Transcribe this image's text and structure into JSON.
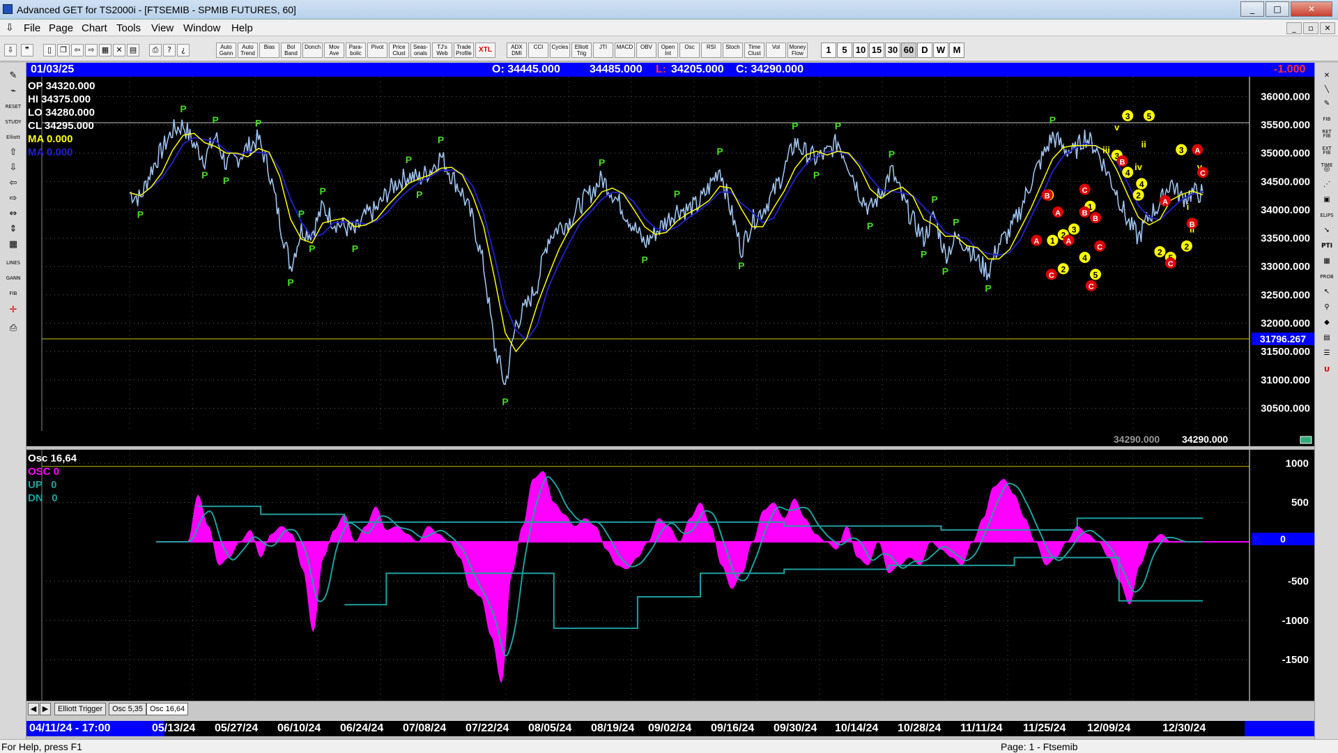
{
  "window": {
    "title": "Advanced GET for TS2000i - [FTSEMIB - SPMIB FUTURES, 60]",
    "min": "_",
    "max": "□",
    "close": "✕",
    "mdi_min": "_",
    "mdi_restore": "▫",
    "mdi_close": "✕"
  },
  "menu": [
    "File",
    "Page",
    "Chart",
    "Tools",
    "View",
    "Window",
    "Help"
  ],
  "toolbar": {
    "study_buttons": [
      "Auto Gann",
      "Auto Trend",
      "Bias",
      "Bol Band",
      "Donch",
      "Mov Ave",
      "Para- bolic",
      "Pivot",
      "Price Clust",
      "Seas- onals",
      "TJ's Web",
      "Trade Profile",
      "XTL",
      "ADX DMI",
      "CCI",
      "Cycles",
      "Elliott Trig",
      "JTI",
      "MACD",
      "OBV",
      "Open Int",
      "Osc",
      "RSI",
      "Stoch",
      "Time Clust",
      "Vol",
      "Money Flow"
    ],
    "timeframes": [
      "1",
      "5",
      "10",
      "15",
      "30",
      "60",
      "D",
      "W",
      "M"
    ]
  },
  "left_tools": [
    "pencil-icon",
    "chart-icon",
    "reset",
    "study",
    "elliott",
    "up-arrow-icon",
    "down-arrow-icon",
    "left-arrow-icon",
    "right-arrow-icon",
    "compress-icon",
    "expand-icon",
    "grid-icon",
    "lines",
    "gann",
    "fib",
    "crosshair-icon",
    "print-icon"
  ],
  "left_labels": [
    "RESET",
    "STUDY",
    "Elliott",
    "LINES",
    "GANN",
    "FIB"
  ],
  "right_labels": [
    "FIB RET",
    "FIB EXT",
    "FIB TIME",
    "ELIPS",
    "PTI",
    "PROB"
  ],
  "info": {
    "date": "01/03/25",
    "open": "O: 34445.000",
    "high": "34485.000",
    "low_label": "L:",
    "low": "34205.000",
    "close": "C: 34290.000",
    "change": "-1.000"
  },
  "price_panel": {
    "readouts": [
      {
        "label": "OP",
        "value": "34320.000"
      },
      {
        "label": "HI",
        "value": "34375.000"
      },
      {
        "label": "LO",
        "value": "34280.000"
      },
      {
        "label": "CL",
        "value": "34295.000"
      }
    ],
    "ma_yellow": "MA  0.000",
    "ma_blue": "MA  0.000",
    "bottom_value_1": "34290.000",
    "bottom_value_2": "34290.000",
    "highlight_value": "31796.267"
  },
  "osc_panel": {
    "title": "Osc 16,64",
    "osc_label": "OSC",
    "osc_value": "0",
    "up_label": "UP",
    "up_value": "0",
    "dn_label": "DN",
    "dn_value": "0",
    "zero_label": "0"
  },
  "tabs": [
    "Elliott Trigger",
    "Osc 5,35",
    "Osc 16,64"
  ],
  "date_axis": {
    "start": "04/11/24 - 17:00",
    "labels": [
      "05/13/24",
      "05/27/24",
      "06/10/24",
      "06/24/24",
      "07/08/24",
      "07/22/24",
      "08/05/24",
      "08/19/24",
      "09/02/24",
      "09/16/24",
      "09/30/24",
      "10/14/24",
      "10/28/24",
      "11/11/24",
      "11/25/24",
      "12/09/24",
      "12/30/24"
    ]
  },
  "status": {
    "left": "For Help, press F1",
    "right": "Page: 1 - Ftsemib"
  },
  "colors": {
    "price_line": "#9ec3ee",
    "ma_yellow": "#ffff00",
    "ma_blue": "#2020c0",
    "pivot_green": "#44dd22",
    "osc_magenta": "#ff00ff",
    "osc_band": "#20a0a0",
    "elliott_red": "#dd0000"
  },
  "chart_data": [
    {
      "type": "line",
      "title": "",
      "y_ticks": [
        "36000.000",
        "35500.000",
        "35000.000",
        "34500.000",
        "34000.000",
        "33500.000",
        "33000.000",
        "32500.000",
        "32000.000",
        "31500.000",
        "31000.000",
        "30500.000"
      ],
      "ylim": [
        30100,
        36250
      ],
      "x_range": [
        0,
        100
      ],
      "series": [
        {
          "values_role": "price",
          "x": [
            0,
            1,
            2,
            3,
            4,
            5,
            6,
            7,
            8,
            9,
            10,
            11,
            12,
            13,
            14,
            15,
            16,
            17,
            18,
            19,
            20,
            21,
            22,
            23,
            24,
            25,
            26,
            27,
            28,
            29,
            30,
            31,
            32,
            33,
            34,
            35,
            36,
            37,
            38,
            39,
            40,
            41,
            42,
            43,
            44,
            45,
            46,
            47,
            48,
            49,
            50,
            51,
            52,
            53,
            54,
            55,
            56,
            57,
            58,
            59,
            60,
            61,
            62,
            63,
            64,
            65,
            66,
            67,
            68,
            69,
            70,
            71,
            72,
            73,
            74,
            75,
            76,
            77,
            78,
            79,
            80,
            81,
            82,
            83,
            84,
            85,
            86,
            87,
            88,
            89,
            90,
            91,
            92,
            93,
            94,
            95,
            96,
            97,
            98,
            99,
            100
          ],
          "values": [
            34300,
            34200,
            34700,
            35050,
            35400,
            35500,
            35150,
            34900,
            35300,
            34800,
            34900,
            35100,
            35250,
            34700,
            33800,
            33000,
            33650,
            33600,
            34050,
            33800,
            33700,
            33600,
            33900,
            34000,
            34300,
            34500,
            34600,
            34550,
            34700,
            34950,
            34600,
            34300,
            33800,
            33000,
            31600,
            30900,
            32000,
            32300,
            32700,
            33500,
            33700,
            33800,
            34100,
            34300,
            34550,
            34300,
            34000,
            33700,
            33400,
            33600,
            33800,
            34000,
            34000,
            34100,
            34400,
            34750,
            34000,
            33300,
            33800,
            34000,
            34300,
            34700,
            35200,
            35000,
            34900,
            35000,
            35200,
            34800,
            34300,
            34000,
            34300,
            34700,
            34200,
            33800,
            33500,
            33900,
            33200,
            33500,
            33400,
            33100,
            32900,
            33400,
            33600,
            34000,
            34500,
            34900,
            35300,
            35100,
            35000,
            35300,
            35100,
            34700,
            34300,
            33800,
            33500,
            33900,
            34100,
            34500,
            34200,
            34300,
            34290
          ]
        },
        {
          "name": "",
          "values_role": "ma_yellow",
          "color": "#ffff00"
        },
        {
          "name": "",
          "values_role": "ma_blue",
          "color": "#2020c0"
        }
      ],
      "pivot_labels": [
        "P"
      ],
      "elliott_labels": [
        "1",
        "2",
        "3",
        "4",
        "5",
        "A",
        "B",
        "C",
        "i",
        "ii",
        "iii",
        "iv",
        "v"
      ]
    },
    {
      "type": "area",
      "title": "Osc 16,64",
      "y_ticks": [
        "1000",
        "500",
        "-500",
        "-1000",
        "-1500"
      ],
      "ylim": [
        -1950,
        1100
      ],
      "series": [
        {
          "name": "OSC",
          "x": [
            0,
            1,
            2,
            3,
            4,
            5,
            6,
            7,
            8,
            9,
            10,
            11,
            12,
            13,
            14,
            15,
            16,
            17,
            18,
            19,
            20,
            21,
            22,
            23,
            24,
            25,
            26,
            27,
            28,
            29,
            30,
            31,
            32,
            33,
            34,
            35,
            36,
            37,
            38,
            39,
            40,
            41,
            42,
            43,
            44,
            45,
            46,
            47,
            48,
            49,
            50,
            51,
            52,
            53,
            54,
            55,
            56,
            57,
            58,
            59,
            60,
            61,
            62,
            63,
            64,
            65,
            66,
            67,
            68,
            69,
            70,
            71,
            72,
            73,
            74,
            75,
            76,
            77,
            78,
            79,
            80,
            81,
            82,
            83,
            84,
            85,
            86,
            87,
            88,
            89,
            90,
            91,
            92,
            93,
            94,
            95,
            96,
            97,
            98,
            99,
            100
          ],
          "values": [
            0,
            0,
            0,
            0,
            600,
            200,
            -300,
            -200,
            0,
            150,
            -200,
            100,
            200,
            100,
            -350,
            -1150,
            -200,
            150,
            350,
            0,
            200,
            450,
            150,
            200,
            100,
            0,
            200,
            100,
            0,
            -200,
            -600,
            -700,
            -1200,
            -1800,
            -400,
            200,
            800,
            900,
            500,
            350,
            200,
            300,
            200,
            -100,
            -300,
            -350,
            -200,
            0,
            300,
            200,
            0,
            300,
            500,
            200,
            -300,
            -600,
            -400,
            0,
            400,
            500,
            300,
            550,
            300,
            100,
            0,
            -100,
            200,
            -200,
            -300,
            0,
            -400,
            -300,
            -200,
            -300,
            0,
            -100,
            -200,
            -300,
            0,
            300,
            700,
            800,
            600,
            300,
            0,
            -300,
            -200,
            0,
            200,
            100,
            0,
            -200,
            -500,
            -800,
            -300,
            0,
            100,
            0,
            0,
            0,
            0
          ]
        },
        {
          "name": "UP",
          "values_role": "up_band",
          "color": "#20a0a0"
        },
        {
          "name": "DN",
          "values_role": "dn_band",
          "color": "#20a0a0"
        }
      ]
    }
  ]
}
